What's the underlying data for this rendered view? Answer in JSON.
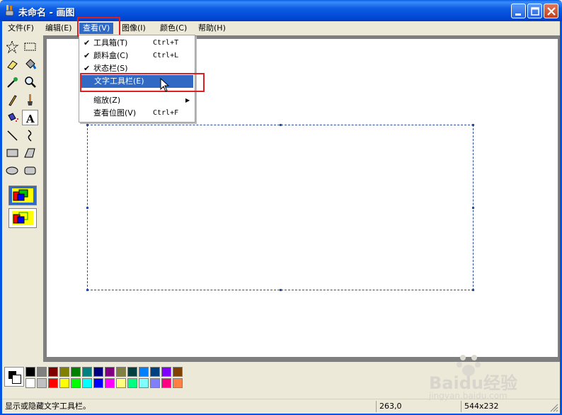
{
  "window": {
    "title": "未命名 - 画图"
  },
  "menubar": {
    "items": [
      {
        "label": "文件(F)"
      },
      {
        "label": "编辑(E)"
      },
      {
        "label": "查看(V)"
      },
      {
        "label": "图像(I)"
      },
      {
        "label": "颜色(C)"
      },
      {
        "label": "帮助(H)"
      }
    ]
  },
  "view_menu": {
    "items": [
      {
        "label": "工具箱(T)",
        "shortcut": "Ctrl+T",
        "checked": "✔"
      },
      {
        "label": "颜料盒(C)",
        "shortcut": "Ctrl+L",
        "checked": "✔"
      },
      {
        "label": "状态栏(S)",
        "shortcut": "",
        "checked": "✔"
      },
      {
        "label": "文字工具栏(E)",
        "shortcut": "",
        "checked": ""
      },
      {
        "label": "缩放(Z)",
        "shortcut": "",
        "arrow": "▶"
      },
      {
        "label": "查看位图(V)",
        "shortcut": "Ctrl+F"
      }
    ]
  },
  "palette": {
    "top_row": [
      "#000000",
      "#808080",
      "#800000",
      "#808000",
      "#008000",
      "#008080",
      "#000080",
      "#800080",
      "#808040",
      "#004040",
      "#0080ff",
      "#004080",
      "#8000ff",
      "#804000"
    ],
    "bottom_row": [
      "#ffffff",
      "#c0c0c0",
      "#ff0000",
      "#ffff00",
      "#00ff00",
      "#00ffff",
      "#0000ff",
      "#ff00ff",
      "#ffff80",
      "#00ff80",
      "#80ffff",
      "#8080ff",
      "#ff0080",
      "#ff8040"
    ]
  },
  "statusbar": {
    "message": "显示或隐藏文字工具栏。",
    "coords": "263,0",
    "size": "544x232"
  },
  "watermark": {
    "brand": "Baidu经验",
    "url": "jingyan.baidu.com"
  },
  "colors": {
    "titlebar": "#0054e3",
    "highlight": "#316ac5",
    "annotation": "#e02020"
  }
}
